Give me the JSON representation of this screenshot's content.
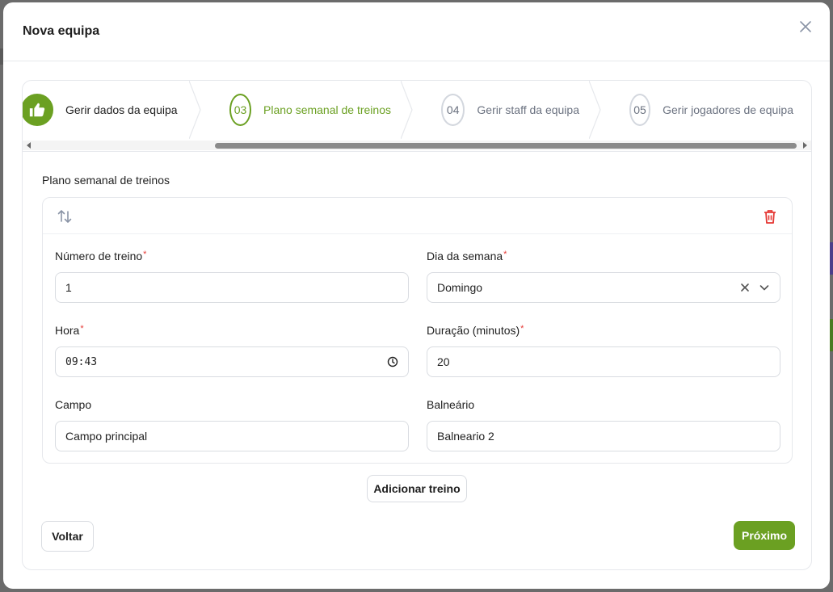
{
  "modal": {
    "title": "Nova equipa"
  },
  "stepper": {
    "steps": [
      {
        "number": "",
        "label": "Gerir dados da equipa",
        "state": "done"
      },
      {
        "number": "03",
        "label": "Plano semanal de treinos",
        "state": "active"
      },
      {
        "number": "04",
        "label": "Gerir staff da equipa",
        "state": "pending"
      },
      {
        "number": "05",
        "label": "Gerir jogadores de equipa",
        "state": "pending"
      }
    ]
  },
  "section": {
    "title": "Plano semanal de treinos"
  },
  "training": {
    "numero": {
      "label": "Número de treino",
      "required": "*",
      "value": "1"
    },
    "dia": {
      "label": "Dia da semana",
      "required": "*",
      "value": "Domingo"
    },
    "hora": {
      "label": "Hora",
      "required": "*",
      "value": "09:43"
    },
    "duracao": {
      "label": "Duração (minutos)",
      "required": "*",
      "value": "20"
    },
    "campo": {
      "label": "Campo",
      "value": "Campo principal"
    },
    "balneario": {
      "label": "Balneário",
      "value": "Balneario 2"
    }
  },
  "actions": {
    "add_label": "Adicionar treino",
    "back_label": "Voltar",
    "next_label": "Próximo"
  },
  "colors": {
    "accent": "#6ba022",
    "danger": "#e53935",
    "muted": "#6b7280"
  },
  "icons": {
    "close": "close-icon",
    "done_step": "thumbs-up-icon",
    "sort": "sort-arrows-icon",
    "delete": "trash-icon",
    "clear": "clear-x-icon",
    "dropdown": "chevron-down-icon",
    "clock": "clock-icon"
  }
}
